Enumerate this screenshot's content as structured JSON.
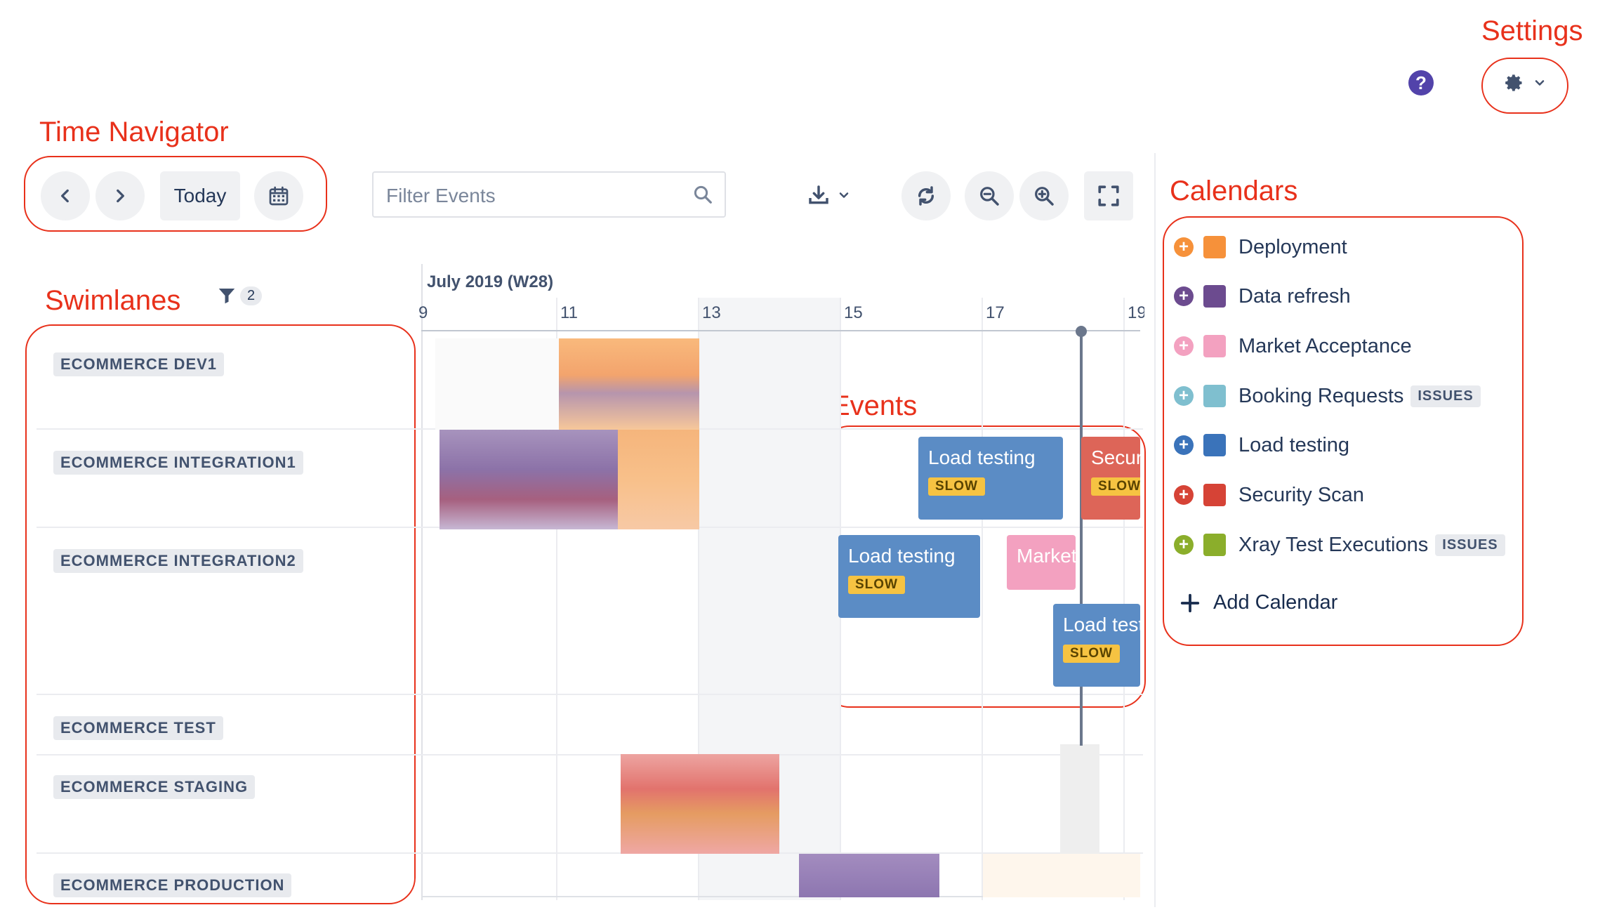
{
  "annotations": {
    "settings": "Settings",
    "time_navigator": "Time Navigator",
    "swimlanes": "Swimlanes",
    "events": "Events",
    "calendars": "Calendars"
  },
  "toolbar": {
    "today_label": "Today",
    "filter_placeholder": "Filter Events",
    "filter_count": "2"
  },
  "timeline": {
    "period_label": "July 2019 (W28)",
    "days": [
      "9",
      "11",
      "13",
      "15",
      "17",
      "19"
    ]
  },
  "swimlanes": [
    {
      "label": "ECOMMERCE DEV1"
    },
    {
      "label": "ECOMMERCE INTEGRATION1"
    },
    {
      "label": "ECOMMERCE INTEGRATION2"
    },
    {
      "label": "ECOMMERCE TEST"
    },
    {
      "label": "ECOMMERCE STAGING"
    },
    {
      "label": "ECOMMERCE PRODUCTION"
    }
  ],
  "events": [
    {
      "title": "Load testing",
      "badge": "SLOW",
      "color": "#5b8cc5"
    },
    {
      "title": "Security Scan",
      "badge": "SLOW",
      "color": "#dd6558"
    },
    {
      "title": "Load testing",
      "badge": "SLOW",
      "color": "#5b8cc5"
    },
    {
      "title": "Market Acceptance",
      "color": "#f3a1c0"
    },
    {
      "title": "Load testing",
      "badge": "SLOW",
      "color": "#5b8cc5"
    }
  ],
  "calendars": [
    {
      "name": "Deployment",
      "color": "#f6913a",
      "badge": ""
    },
    {
      "name": "Data refresh",
      "color": "#6c4b8f",
      "badge": ""
    },
    {
      "name": "Market Acceptance",
      "color": "#f3a1c0",
      "badge": ""
    },
    {
      "name": "Booking Requests",
      "color": "#7fbfcf",
      "badge": "ISSUES"
    },
    {
      "name": "Load testing",
      "color": "#3a73ba",
      "badge": ""
    },
    {
      "name": "Security Scan",
      "color": "#d64336",
      "badge": ""
    },
    {
      "name": "Xray Test Executions",
      "color": "#8bae2b",
      "badge": "ISSUES"
    }
  ],
  "add_calendar_label": "Add Calendar"
}
